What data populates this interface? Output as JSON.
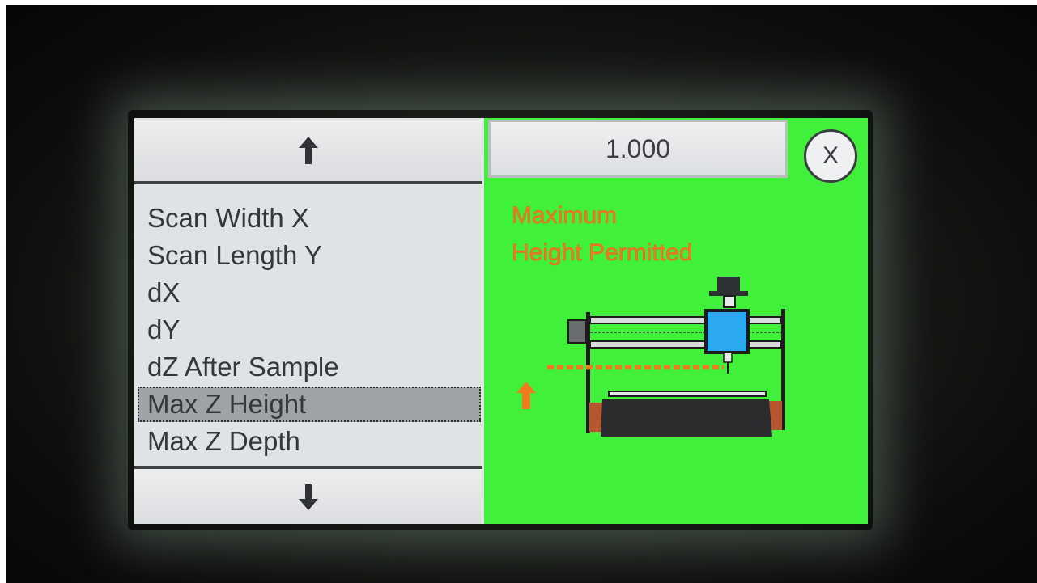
{
  "param_list": {
    "items": [
      {
        "label": "Scan Width X",
        "selected": false
      },
      {
        "label": "Scan Length Y",
        "selected": false
      },
      {
        "label": "dX",
        "selected": false
      },
      {
        "label": "dY",
        "selected": false
      },
      {
        "label": "dZ After Sample",
        "selected": false
      },
      {
        "label": "Max Z Height",
        "selected": true
      },
      {
        "label": "Max Z Depth",
        "selected": false
      }
    ]
  },
  "value_display": {
    "value": "1.000"
  },
  "close_button": {
    "label": "X"
  },
  "description": {
    "line1": "Maximum",
    "line2": "Height Permitted"
  },
  "colors": {
    "screen_background": "#40f03a",
    "panel": "#dfe3e6",
    "accent_orange": "#f27a1e",
    "selection": "#9ea3a7",
    "carriage_blue": "#2aa8f0"
  },
  "icons": {
    "scroll_up": "arrow-up-icon",
    "scroll_down": "arrow-down-icon",
    "height_indicator": "orange-arrow-up-icon"
  }
}
